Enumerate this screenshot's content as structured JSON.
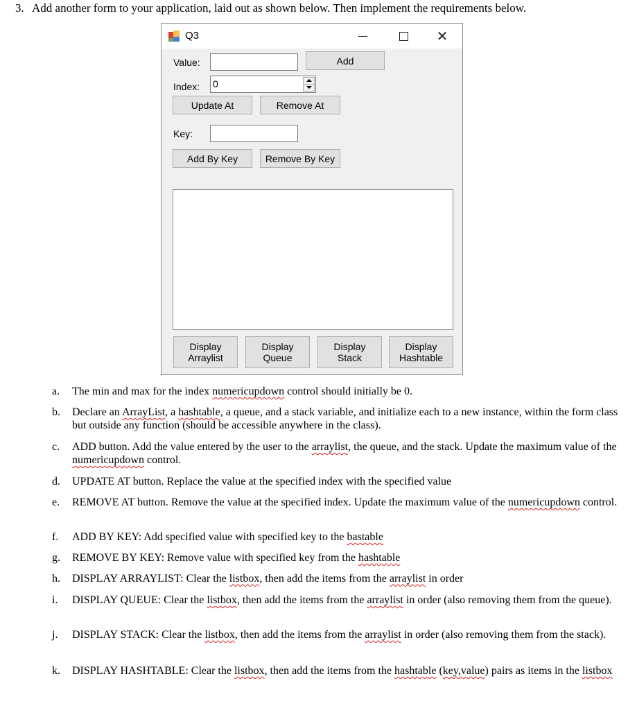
{
  "question": {
    "number": "3.",
    "text": "Add another form to your application, laid out as shown below. Then implement the requirements below."
  },
  "form": {
    "title": "Q3",
    "icon": "winforms-app-icon",
    "window_controls": {
      "minimize": "minimize-icon",
      "maximize": "maximize-icon",
      "close": "close-icon"
    },
    "value_label": "Value:",
    "value_input": "",
    "add_button": "Add",
    "index_label": "Index:",
    "index_value": "0",
    "update_at_button": "Update At",
    "remove_at_button": "Remove At",
    "key_label": "Key:",
    "key_input": "",
    "add_by_key_button": "Add By Key",
    "remove_by_key_button": "Remove By Key",
    "listbox_items": [],
    "display_buttons": [
      {
        "line1": "Display",
        "line2": "Arraylist"
      },
      {
        "line1": "Display",
        "line2": "Queue"
      },
      {
        "line1": "Display",
        "line2": "Stack"
      },
      {
        "line1": "Display",
        "line2": "Hashtable"
      }
    ]
  },
  "requirements": [
    {
      "letter": "a.",
      "parts": [
        {
          "t": "The min and max for the index "
        },
        {
          "t": "numericupdown",
          "sq": true
        },
        {
          "t": " control should initially be 0."
        }
      ]
    },
    {
      "letter": "b.",
      "parts": [
        {
          "t": "Declare an "
        },
        {
          "t": "ArrayList",
          "sq": true
        },
        {
          "t": ", a "
        },
        {
          "t": "hashtable",
          "sq": true
        },
        {
          "t": ", a queue, and a stack variable, and initialize each to a new instance, within the form class but outside any function (should be accessible anywhere in the class)."
        }
      ]
    },
    {
      "letter": "c.",
      "parts": [
        {
          "t": "ADD button. Add the value entered by the user to the "
        },
        {
          "t": "arraylist",
          "sq": true
        },
        {
          "t": ", the queue, and the stack. Update the maximum value of the "
        },
        {
          "t": "numericupdown",
          "sq": true
        },
        {
          "t": " control."
        }
      ]
    },
    {
      "letter": "d.",
      "parts": [
        {
          "t": "UPDATE AT button. Replace the value at the specified index with the specified value"
        }
      ]
    },
    {
      "letter": "e.",
      "parts": [
        {
          "t": "REMOVE AT button. Remove the value at the specified index. Update the maximum value of the "
        },
        {
          "t": "numericupdown",
          "sq": true
        },
        {
          "t": " control."
        }
      ]
    },
    {
      "letter": "f.",
      "parts": [
        {
          "t": "ADD BY KEY: Add specified value with specified key to the "
        },
        {
          "t": "bastable",
          "sq": true
        }
      ]
    },
    {
      "letter": "g.",
      "parts": [
        {
          "t": "REMOVE BY KEY: Remove value with specified key from the "
        },
        {
          "t": "hashtable",
          "sq": true
        }
      ]
    },
    {
      "letter": "h.",
      "parts": [
        {
          "t": "DISPLAY ARRAYLIST: Clear the "
        },
        {
          "t": "listbox",
          "sq": true
        },
        {
          "t": ", then add the items from the "
        },
        {
          "t": "arraylist",
          "sq": true
        },
        {
          "t": " in order"
        }
      ]
    },
    {
      "letter": "i.",
      "parts": [
        {
          "t": "DISPLAY QUEUE: Clear the "
        },
        {
          "t": "listbox",
          "sq": true
        },
        {
          "t": ", then add the items from the "
        },
        {
          "t": "arraylist",
          "sq": true
        },
        {
          "t": " in order (also removing them from the queue)."
        }
      ]
    },
    {
      "letter": "j.",
      "parts": [
        {
          "t": "DISPLAY STACK: Clear the "
        },
        {
          "t": "listbox",
          "sq": true
        },
        {
          "t": ", then add the items from the "
        },
        {
          "t": "arraylist",
          "sq": true
        },
        {
          "t": " in order (also removing them from the stack)."
        }
      ]
    },
    {
      "letter": "k.",
      "parts": [
        {
          "t": "DISPLAY HASHTABLE: Clear the "
        },
        {
          "t": "listbox",
          "sq": true
        },
        {
          "t": ", then add the items from the "
        },
        {
          "t": "hashtable",
          "sq": true
        },
        {
          "t": " ("
        },
        {
          "t": "key,value",
          "sq": true
        },
        {
          "t": ") pairs as items in the "
        },
        {
          "t": "listbox",
          "sq": true
        }
      ]
    }
  ]
}
